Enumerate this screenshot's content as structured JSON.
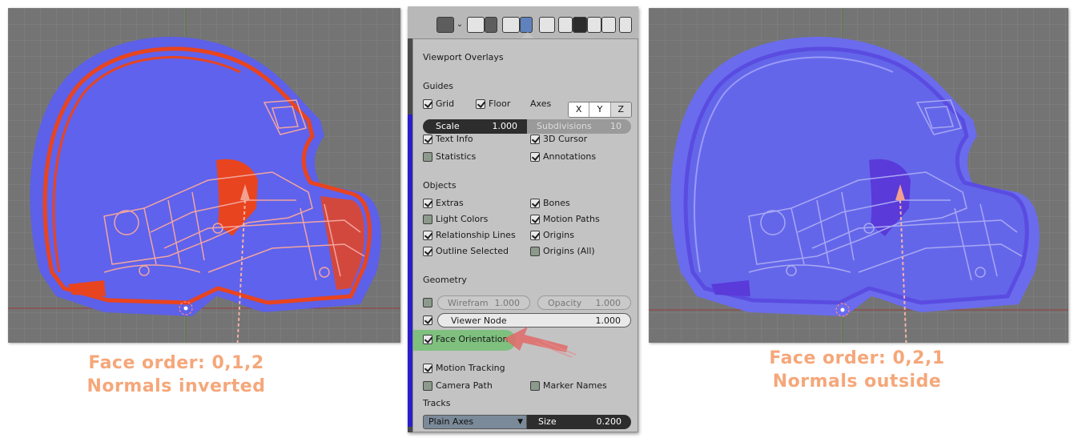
{
  "captions": {
    "left_line1": "Face order: 0,1,2",
    "left_line2": "Normals inverted",
    "right_line1": "Face order: 0,2,1",
    "right_line2": "Normals outside"
  },
  "colors": {
    "caption": "#f5a77a",
    "inverted_face": "#e8441f",
    "outside_face": "#6360e6",
    "viewport_bg": "#747474",
    "highlight": "#7fc07f"
  },
  "header_icons": [
    "visibility-icon",
    "gizmo-icon",
    "overlay-icon",
    "xray-icon",
    "wireframe-shading-icon",
    "solid-shading-icon",
    "material-shading-icon",
    "rendered-shading-icon"
  ],
  "popup": {
    "title": "Viewport Overlays",
    "guides": {
      "heading": "Guides",
      "grid": "Grid",
      "floor": "Floor",
      "axes_label": "Axes",
      "axis_x": "X",
      "axis_y": "Y",
      "axis_z": "Z",
      "scale_label": "Scale",
      "scale_value": "1.000",
      "subdiv_label": "Subdivisions",
      "subdiv_value": "10",
      "text_info": "Text Info",
      "cursor_3d": "3D Cursor",
      "statistics": "Statistics",
      "annotations": "Annotations"
    },
    "objects": {
      "heading": "Objects",
      "extras": "Extras",
      "bones": "Bones",
      "light_colors": "Light Colors",
      "motion_paths": "Motion Paths",
      "relationship_lines": "Relationship Lines",
      "origins": "Origins",
      "outline_selected": "Outline Selected",
      "origins_all": "Origins (All)"
    },
    "geometry": {
      "heading": "Geometry",
      "wireframe_label": "Wirefram",
      "wireframe_value": "1.000",
      "opacity_label": "Opacity",
      "opacity_value": "1.000",
      "viewer_label": "Viewer Node",
      "viewer_value": "1.000",
      "face_orientation": "Face Orientation"
    },
    "misc": {
      "motion_tracking": "Motion Tracking",
      "camera_path": "Camera Path",
      "marker_names": "Marker Names"
    },
    "tracks": {
      "heading": "Tracks",
      "display": "Plain Axes",
      "size_label": "Size",
      "size_value": "0.200"
    }
  }
}
